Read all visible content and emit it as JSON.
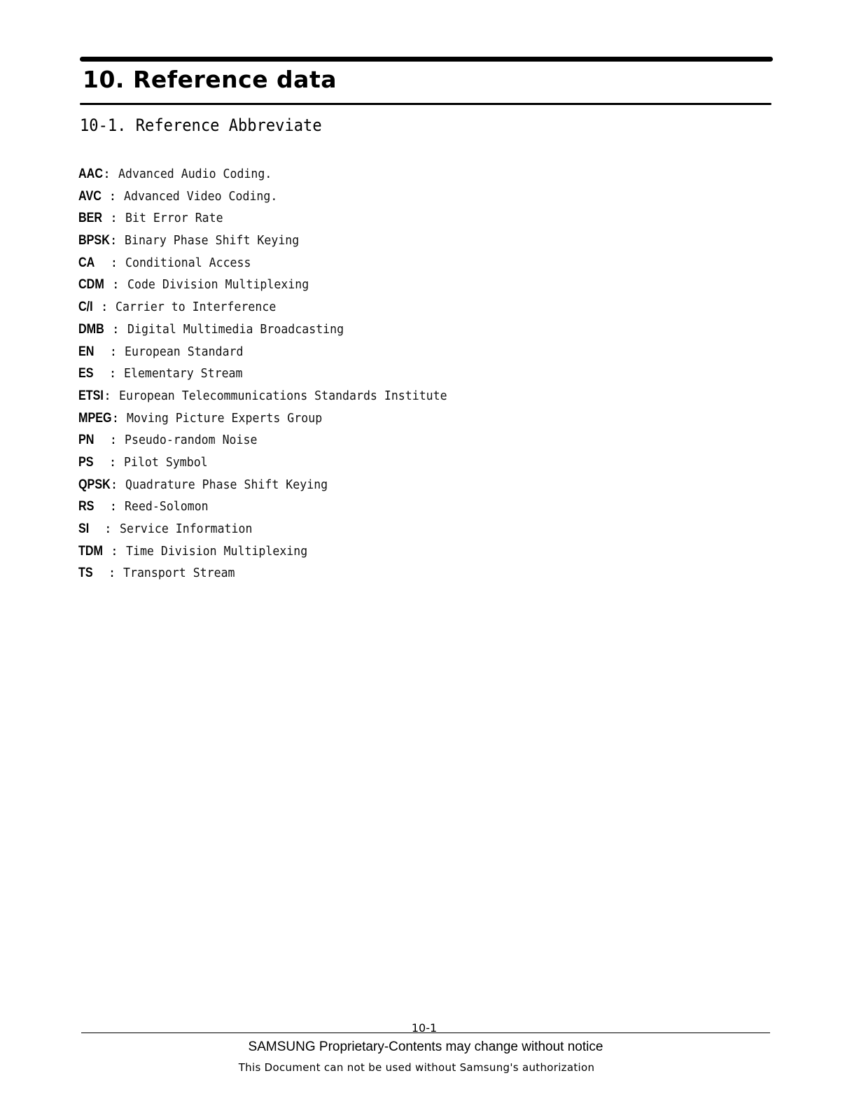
{
  "header": {
    "title": "10. Reference data",
    "subtitle": "10-1. Reference Abbreviate"
  },
  "abbreviations": [
    {
      "abbr": "AAC",
      "sep": ": ",
      "definition": "Advanced Audio Coding."
    },
    {
      "abbr": "AVC",
      "sep": " : ",
      "definition": "Advanced Video Coding."
    },
    {
      "abbr": "BER",
      "sep": " : ",
      "definition": "Bit Error Rate"
    },
    {
      "abbr": "BPSK",
      "sep": ": ",
      "definition": "Binary Phase Shift Keying"
    },
    {
      "abbr": "CA",
      "sep": "  : ",
      "definition": "Conditional Access"
    },
    {
      "abbr": "CDM",
      "sep": " : ",
      "definition": "Code Division Multiplexing"
    },
    {
      "abbr": "C/I",
      "sep": " : ",
      "definition": "Carrier to Interference"
    },
    {
      "abbr": "DMB",
      "sep": " : ",
      "definition": "Digital Multimedia Broadcasting"
    },
    {
      "abbr": "EN",
      "sep": "  : ",
      "definition": "European Standard"
    },
    {
      "abbr": "ES",
      "sep": "  : ",
      "definition": "Elementary Stream"
    },
    {
      "abbr": "ETSI",
      "sep": ": ",
      "definition": "European Telecommunications Standards Institute"
    },
    {
      "abbr": "MPEG",
      "sep": ": ",
      "definition": "Moving Picture Experts Group"
    },
    {
      "abbr": "PN",
      "sep": "  : ",
      "definition": "Pseudo-random Noise"
    },
    {
      "abbr": "PS",
      "sep": "  : ",
      "definition": "Pilot Symbol"
    },
    {
      "abbr": "QPSK",
      "sep": ": ",
      "definition": "Quadrature Phase Shift Keying"
    },
    {
      "abbr": "RS",
      "sep": "  : ",
      "definition": "Reed-Solomon"
    },
    {
      "abbr": "SI",
      "sep": "  : ",
      "definition": "Service Information"
    },
    {
      "abbr": "TDM",
      "sep": " : ",
      "definition": "Time Division Multiplexing"
    },
    {
      "abbr": "TS",
      "sep": "  : ",
      "definition": "Transport Stream"
    }
  ],
  "footer": {
    "page_number": "10-1",
    "notice": "SAMSUNG Proprietary-Contents may change without notice",
    "authorization": "This Document can not be used without Samsung's authorization"
  }
}
